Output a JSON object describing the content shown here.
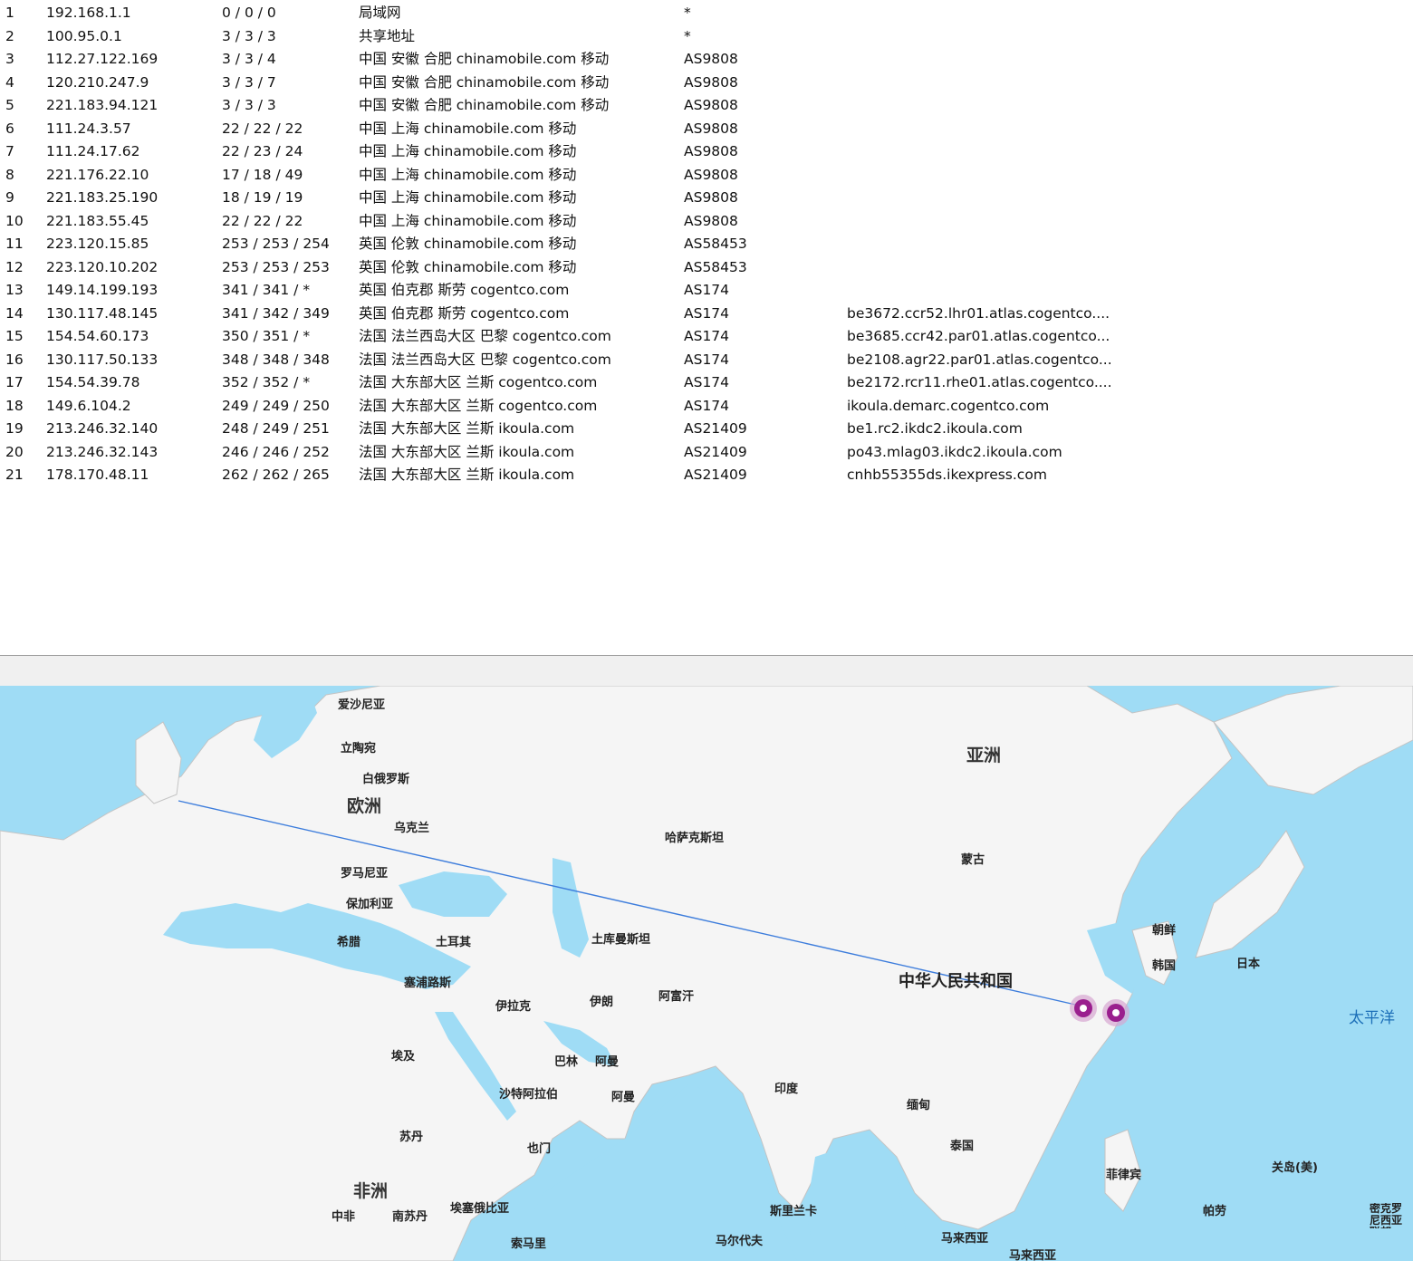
{
  "trace": {
    "rows": [
      {
        "hop": "1",
        "ip": "192.168.1.1",
        "latency": "0 / 0 / 0",
        "location": "局域网",
        "asn": "*",
        "host": ""
      },
      {
        "hop": "2",
        "ip": "100.95.0.1",
        "latency": "3 / 3 / 3",
        "location": "共享地址",
        "asn": "*",
        "host": ""
      },
      {
        "hop": "3",
        "ip": "112.27.122.169",
        "latency": "3 / 3 / 4",
        "location": "中国 安徽 合肥 chinamobile.com 移动",
        "asn": "AS9808",
        "host": ""
      },
      {
        "hop": "4",
        "ip": "120.210.247.9",
        "latency": "3 / 3 / 7",
        "location": "中国 安徽 合肥 chinamobile.com 移动",
        "asn": "AS9808",
        "host": ""
      },
      {
        "hop": "5",
        "ip": "221.183.94.121",
        "latency": "3 / 3 / 3",
        "location": "中国 安徽 合肥 chinamobile.com 移动",
        "asn": "AS9808",
        "host": ""
      },
      {
        "hop": "6",
        "ip": "111.24.3.57",
        "latency": "22 / 22 / 22",
        "location": "中国 上海 chinamobile.com 移动",
        "asn": "AS9808",
        "host": ""
      },
      {
        "hop": "7",
        "ip": "111.24.17.62",
        "latency": "22 / 23 / 24",
        "location": "中国 上海 chinamobile.com 移动",
        "asn": "AS9808",
        "host": ""
      },
      {
        "hop": "8",
        "ip": "221.176.22.10",
        "latency": "17 / 18 / 49",
        "location": "中国 上海 chinamobile.com 移动",
        "asn": "AS9808",
        "host": ""
      },
      {
        "hop": "9",
        "ip": "221.183.25.190",
        "latency": "18 / 19 / 19",
        "location": "中国 上海 chinamobile.com 移动",
        "asn": "AS9808",
        "host": ""
      },
      {
        "hop": "10",
        "ip": "221.183.55.45",
        "latency": "22 / 22 / 22",
        "location": "中国 上海 chinamobile.com 移动",
        "asn": "AS9808",
        "host": ""
      },
      {
        "hop": "11",
        "ip": "223.120.15.85",
        "latency": "253 / 253 / 254",
        "location": "英国 伦敦 chinamobile.com 移动",
        "asn": "AS58453",
        "host": ""
      },
      {
        "hop": "12",
        "ip": "223.120.10.202",
        "latency": "253 / 253 / 253",
        "location": "英国 伦敦 chinamobile.com 移动",
        "asn": "AS58453",
        "host": ""
      },
      {
        "hop": "13",
        "ip": "149.14.199.193",
        "latency": "341 / 341 / *",
        "location": "英国 伯克郡 斯劳 cogentco.com",
        "asn": "AS174",
        "host": ""
      },
      {
        "hop": "14",
        "ip": "130.117.48.145",
        "latency": "341 / 342 / 349",
        "location": "英国 伯克郡 斯劳 cogentco.com",
        "asn": "AS174",
        "host": "be3672.ccr52.lhr01.atlas.cogentco...."
      },
      {
        "hop": "15",
        "ip": "154.54.60.173",
        "latency": "350 / 351 / *",
        "location": "法国 法兰西岛大区 巴黎 cogentco.com",
        "asn": "AS174",
        "host": "be3685.ccr42.par01.atlas.cogentco..."
      },
      {
        "hop": "16",
        "ip": "130.117.50.133",
        "latency": "348 / 348 / 348",
        "location": "法国 法兰西岛大区 巴黎 cogentco.com",
        "asn": "AS174",
        "host": "be2108.agr22.par01.atlas.cogentco..."
      },
      {
        "hop": "17",
        "ip": "154.54.39.78",
        "latency": "352 / 352 / *",
        "location": "法国 大东部大区 兰斯 cogentco.com",
        "asn": "AS174",
        "host": "be2172.rcr11.rhe01.atlas.cogentco...."
      },
      {
        "hop": "18",
        "ip": "149.6.104.2",
        "latency": "249 / 249 / 250",
        "location": "法国 大东部大区 兰斯 cogentco.com",
        "asn": "AS174",
        "host": "ikoula.demarc.cogentco.com"
      },
      {
        "hop": "19",
        "ip": "213.246.32.140",
        "latency": "248 / 249 / 251",
        "location": "法国 大东部大区 兰斯 ikoula.com",
        "asn": "AS21409",
        "host": "be1.rc2.ikdc2.ikoula.com"
      },
      {
        "hop": "20",
        "ip": "213.246.32.143",
        "latency": "246 / 246 / 252",
        "location": "法国 大东部大区 兰斯 ikoula.com",
        "asn": "AS21409",
        "host": "po43.mlag03.ikdc2.ikoula.com"
      },
      {
        "hop": "21",
        "ip": "178.170.48.11",
        "latency": "262 / 262 / 265",
        "location": "法国 大东部大区 兰斯 ikoula.com",
        "asn": "AS21409",
        "host": "cnhb55355ds.ikexpress.com"
      }
    ]
  },
  "map": {
    "labels": {
      "estonia": "爱沙尼亚",
      "lithuania": "立陶宛",
      "belarus": "白俄罗斯",
      "europe": "欧洲",
      "ukraine": "乌克兰",
      "romania": "罗马尼亚",
      "bulgaria": "保加利亚",
      "greece": "希腊",
      "turkey": "土耳其",
      "cyprus": "塞浦路斯",
      "iraq": "伊拉克",
      "iran": "伊朗",
      "afghanistan": "阿富汗",
      "kazakhstan": "哈萨克斯坦",
      "turkmenistan": "土库曼斯坦",
      "asia": "亚洲",
      "mongolia": "蒙古",
      "north_korea": "朝鲜",
      "south_korea": "韩国",
      "japan": "日本",
      "china": "中华人民共和国",
      "pacific": "太平洋",
      "egypt": "埃及",
      "bahrain": "巴林",
      "oman1": "阿曼",
      "saudi": "沙特阿拉伯",
      "oman2": "阿曼",
      "india": "印度",
      "myanmar": "缅甸",
      "sudan": "苏丹",
      "yemen": "也门",
      "thailand": "泰国",
      "philippines": "菲律宾",
      "guam": "关岛(美)",
      "africa": "非洲",
      "car": "中非",
      "south_sudan": "南苏丹",
      "ethiopia": "埃塞俄比亚",
      "sri_lanka": "斯里兰卡",
      "palau": "帕劳",
      "micronesia": "密克罗尼西亚联邦",
      "somalia": "索马里",
      "maldives": "马尔代夫",
      "malaysia1": "马来西亚",
      "malaysia2": "马来西亚"
    },
    "colors": {
      "ocean": "#9fdcf5",
      "land": "#f5f5f5",
      "border": "#c4c4c4",
      "route": "#3d7ddc",
      "marker": "#9a1f8e"
    }
  }
}
